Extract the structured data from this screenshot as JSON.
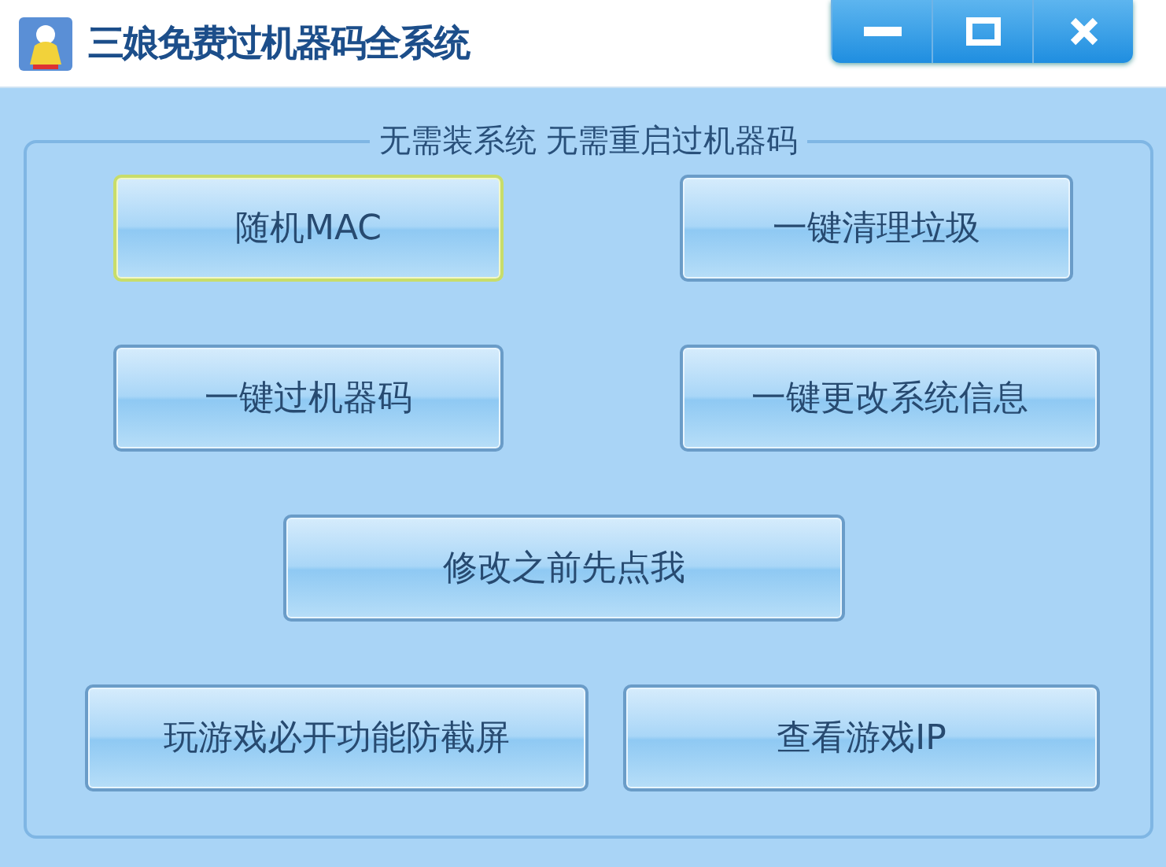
{
  "window": {
    "title": "三娘免费过机器码全系统",
    "controls": [
      {
        "kind": "minimize"
      },
      {
        "kind": "maximize"
      },
      {
        "kind": "close"
      }
    ]
  },
  "group": {
    "legend": "无需装系统 无需重启过机器码",
    "rows": [
      [
        {
          "label": "随机MAC",
          "focused": true
        },
        {
          "label": "一键清理垃圾",
          "focused": false
        }
      ],
      [
        {
          "label": "一键过机器码",
          "focused": false
        },
        {
          "label": "一键更改系统信息",
          "focused": false
        }
      ],
      [
        {
          "label": "修改之前先点我",
          "focused": false
        }
      ],
      [
        {
          "label": "玩游戏必开功能防截屏",
          "focused": false
        },
        {
          "label": "查看游戏IP",
          "focused": false
        }
      ]
    ]
  }
}
